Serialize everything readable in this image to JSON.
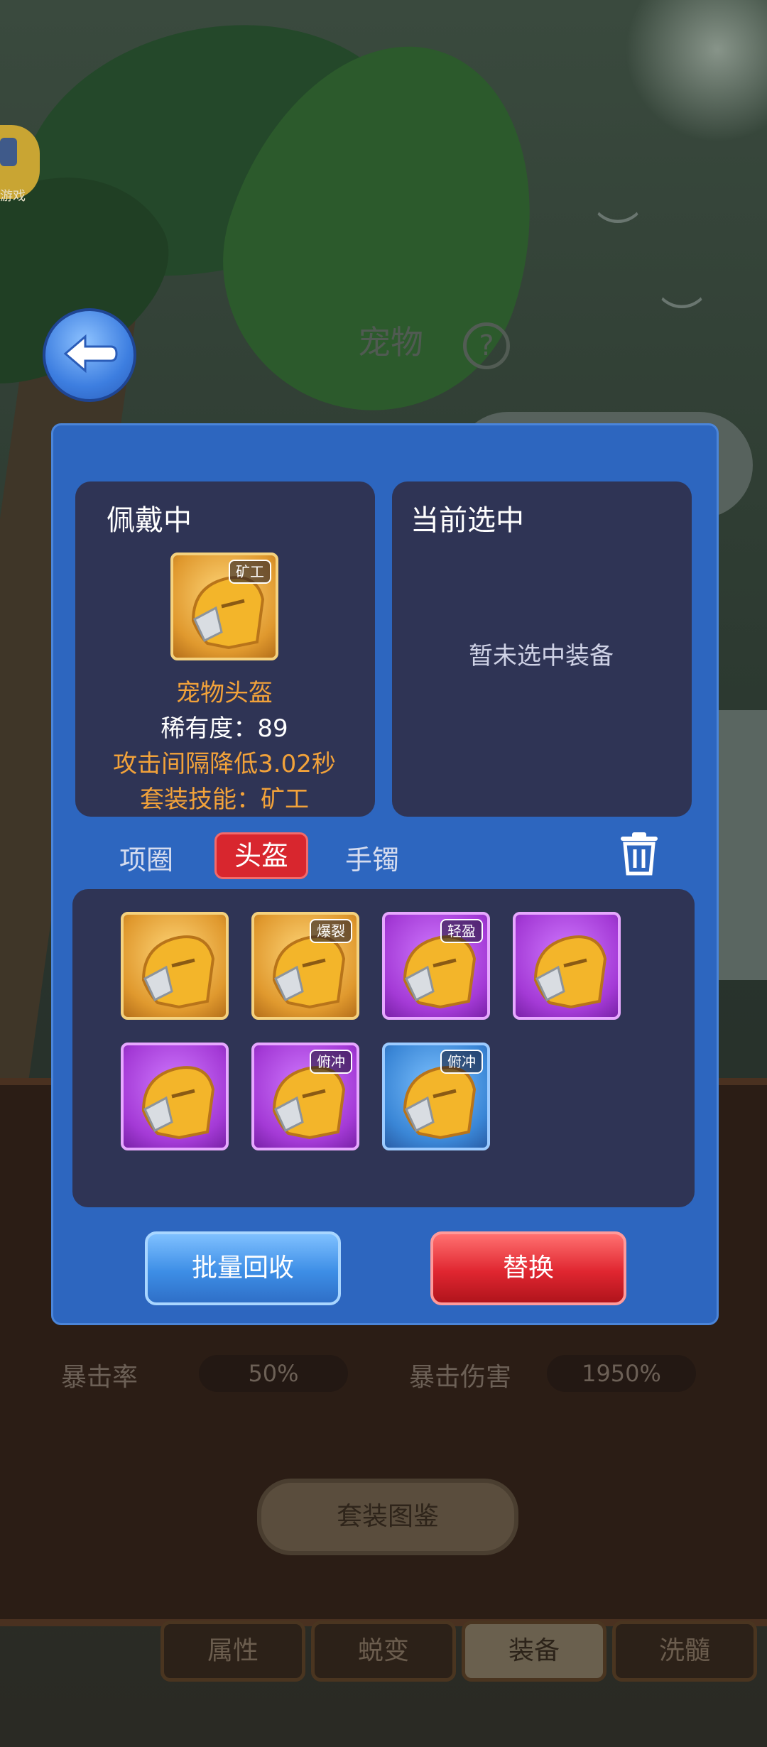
{
  "side_game": {
    "label": "游戏"
  },
  "header": {
    "title": "宠物",
    "help_symbol": "?"
  },
  "worn_card": {
    "title": "佩戴中",
    "item_tag": "矿工",
    "item_name": "宠物头盔",
    "rarity": "稀有度：89",
    "effect": "攻击间隔降低3.02秒",
    "set_skill": "套装技能：矿工"
  },
  "selected_card": {
    "title": "当前选中",
    "empty_text": "暂未选中装备"
  },
  "tabs": [
    {
      "label": "项圈",
      "active": false
    },
    {
      "label": "头盔",
      "active": true
    },
    {
      "label": "手镯",
      "active": false
    }
  ],
  "inventory": [
    {
      "rarity": "gold",
      "tag": ""
    },
    {
      "rarity": "gold",
      "tag": "爆裂"
    },
    {
      "rarity": "purple",
      "tag": "轻盈"
    },
    {
      "rarity": "purple",
      "tag": ""
    },
    {
      "rarity": "purple",
      "tag": ""
    },
    {
      "rarity": "purple",
      "tag": "俯冲"
    },
    {
      "rarity": "blue",
      "tag": "俯冲"
    }
  ],
  "buttons": {
    "batch_recycle": "批量回收",
    "replace": "替换"
  },
  "stats": {
    "crit_rate_label": "暴击率",
    "crit_rate_value": "50%",
    "crit_damage_label": "暴击伤害",
    "crit_damage_value": "1950%"
  },
  "set_collection_button": "套装图鉴",
  "bottom_tabs": [
    {
      "label": "属性",
      "active": false
    },
    {
      "label": "蜕变",
      "active": false
    },
    {
      "label": "装备",
      "active": true
    },
    {
      "label": "洗髓",
      "active": false
    }
  ],
  "colors": {
    "dialog_bg": "#2d66bf",
    "card_bg": "#2f3455",
    "accent_orange": "#f2a23a",
    "active_tab_red": "#d8262e"
  }
}
